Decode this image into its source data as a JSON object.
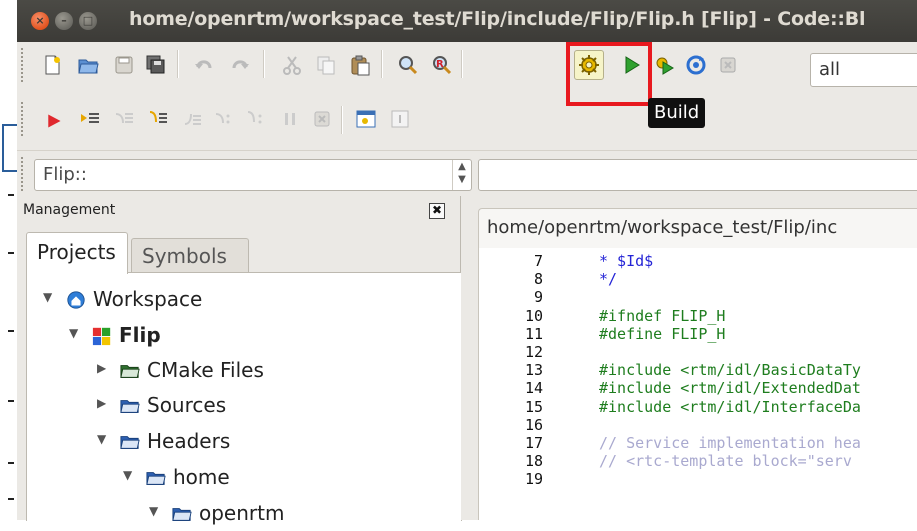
{
  "window": {
    "title": "home/openrtm/workspace_test/Flip/include/Flip/Flip.h [Flip] - Code::Bl"
  },
  "toolbar": {
    "target_value": "all",
    "build_tooltip": "Build",
    "highlight_color": "#e8191f",
    "icons_row1": [
      "new-file-icon",
      "open-icon",
      "save-icon",
      "save-all-icon",
      "undo-icon",
      "redo-icon",
      "cut-icon",
      "copy-icon",
      "paste-icon",
      "find-icon",
      "replace-icon",
      "build-icon",
      "run-icon",
      "build-and-run-icon",
      "rebuild-icon",
      "abort-icon"
    ],
    "icons_row2": [
      "debug-run-icon",
      "run-to-cursor-icon",
      "next-line-icon",
      "step-into-icon",
      "step-out-icon",
      "next-instruction-icon",
      "step-into-instruction-icon",
      "break-icon",
      "stop-debugger-icon",
      "debug-windows-icon",
      "info-icon"
    ]
  },
  "scope": {
    "value": "Flip::"
  },
  "management": {
    "title": "Management",
    "close_glyph": "✖",
    "tabs": [
      {
        "label": "Projects"
      },
      {
        "label": "Symbols"
      }
    ],
    "tree": [
      {
        "label": "Workspace",
        "icon": "workspace-icon"
      },
      {
        "label": "Flip",
        "icon": "project-icon"
      },
      {
        "label": "CMake Files",
        "icon": "folder-icon"
      },
      {
        "label": "Sources",
        "icon": "folder-icon"
      },
      {
        "label": "Headers",
        "icon": "folder-icon"
      },
      {
        "label": "home",
        "icon": "folder-icon"
      },
      {
        "label": "openrtm",
        "icon": "folder-icon"
      }
    ]
  },
  "editor": {
    "tab_title": "home/openrtm/workspace_test/Flip/inc",
    "lines": [
      {
        "num": "7",
        "text": " * $Id$",
        "color": "#2424d6"
      },
      {
        "num": "8",
        "text": " */",
        "color": "#2424d6"
      },
      {
        "num": "9",
        "text": "",
        "color": "#111111"
      },
      {
        "num": "10",
        "text": "#ifndef FLIP_H",
        "color": "#1e7d1e"
      },
      {
        "num": "11",
        "text": "#define FLIP_H",
        "color": "#1e7d1e"
      },
      {
        "num": "12",
        "text": "",
        "color": "#111111"
      },
      {
        "num": "13",
        "text": "#include <rtm/idl/BasicDataTy",
        "color": "#1e7d1e"
      },
      {
        "num": "14",
        "text": "#include <rtm/idl/ExtendedDat",
        "color": "#1e7d1e"
      },
      {
        "num": "15",
        "text": "#include <rtm/idl/InterfaceDa",
        "color": "#1e7d1e"
      },
      {
        "num": "16",
        "text": "",
        "color": "#111111"
      },
      {
        "num": "17",
        "text": "// Service implementation hea",
        "color": "#a9a9cf"
      },
      {
        "num": "18",
        "text": "// <rtc-template block=\"serv",
        "color": "#a9a9cf"
      },
      {
        "num": "19",
        "text": "",
        "color": "#111111"
      }
    ]
  }
}
